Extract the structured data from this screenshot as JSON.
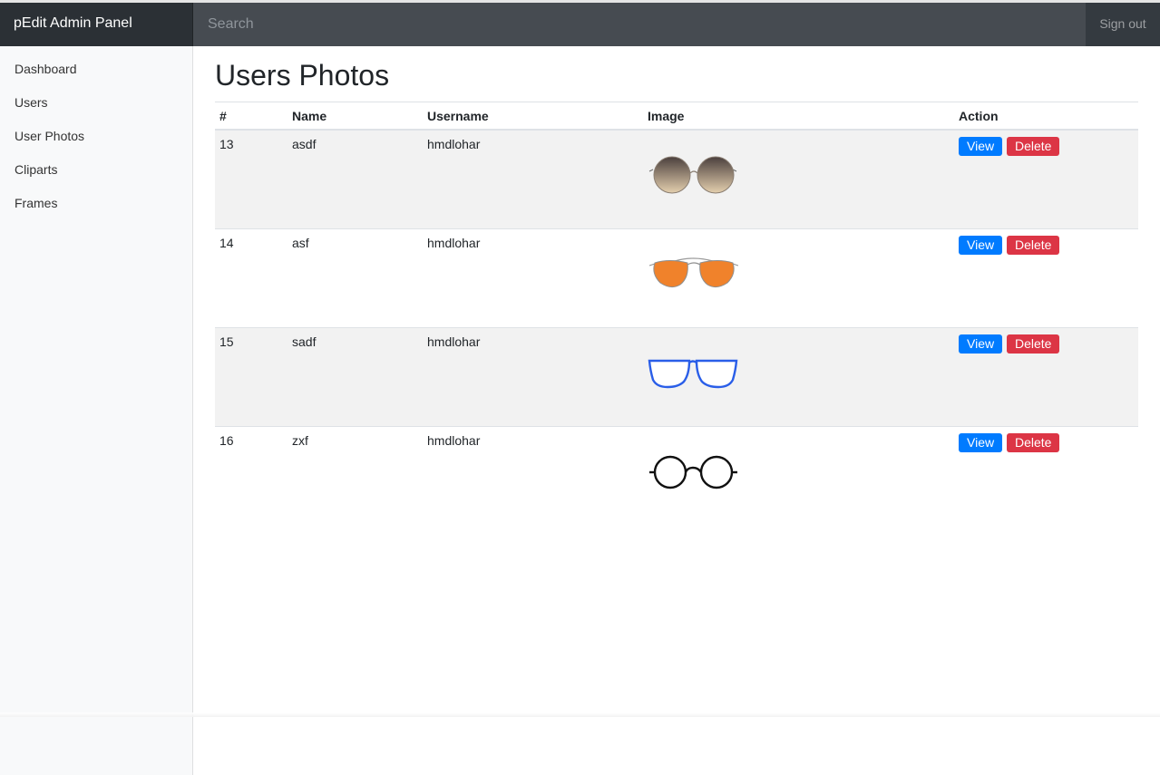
{
  "navbar": {
    "brand": "pEdit Admin Panel",
    "search_placeholder": "Search",
    "signout": "Sign out"
  },
  "sidebar": {
    "items": [
      {
        "label": "Dashboard"
      },
      {
        "label": "Users"
      },
      {
        "label": "User Photos"
      },
      {
        "label": "Cliparts"
      },
      {
        "label": "Frames"
      }
    ]
  },
  "main": {
    "title": "Users Photos",
    "table": {
      "headers": [
        "#",
        "Name",
        "Username",
        "Image",
        "Action"
      ],
      "rows": [
        {
          "id": "13",
          "name": "asdf",
          "username": "hmdlohar",
          "image": "round-gradient-sunglasses"
        },
        {
          "id": "14",
          "name": "asf",
          "username": "hmdlohar",
          "image": "orange-aviator-sunglasses"
        },
        {
          "id": "15",
          "name": "sadf",
          "username": "hmdlohar",
          "image": "blue-rectangular-glasses"
        },
        {
          "id": "16",
          "name": "zxf",
          "username": "hmdlohar",
          "image": "black-round-glasses"
        }
      ],
      "view_label": "View",
      "delete_label": "Delete"
    }
  },
  "colors": {
    "navbar": "#343a40",
    "brand_bg": "#2b3035",
    "view_button": "#007bff",
    "delete_button": "#dc3545",
    "sidebar_bg": "#f8f9fa"
  }
}
